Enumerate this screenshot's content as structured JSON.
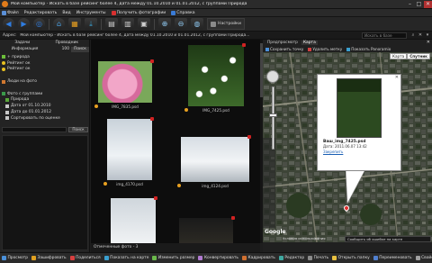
{
  "window": {
    "title": "Мой компьютер - Искать в базе рейсинг более 4, дата между 01.10.2010 и 01.01.2012, с группами Природа",
    "controls": [
      "–",
      "□",
      "✕"
    ]
  },
  "menu": [
    {
      "label": "Файл",
      "color": "#5a8fd6"
    },
    {
      "label": "Редактировать",
      "color": ""
    },
    {
      "label": "Вид",
      "color": ""
    },
    {
      "label": "Инструменты",
      "color": ""
    },
    {
      "label": "Получить фотографии",
      "color": "#d83030"
    },
    {
      "label": "Справка",
      "color": "#3a7bd5"
    }
  ],
  "toolbar": {
    "buttons": [
      {
        "icon": "back-icon",
        "glyph": "◀"
      },
      {
        "icon": "forward-icon",
        "glyph": "▶"
      },
      {
        "icon": "globe-icon",
        "glyph": "◎"
      },
      {
        "icon": "home-icon",
        "glyph": "⌂"
      },
      {
        "icon": "folder-icon",
        "glyph": "▦"
      },
      {
        "icon": "import-icon",
        "glyph": "⤓"
      },
      {
        "icon": "view-icon",
        "glyph": "▤"
      },
      {
        "icon": "grid-icon",
        "glyph": "▥"
      },
      {
        "icon": "slideshow-icon",
        "glyph": "▣"
      },
      {
        "icon": "zoom-in-icon",
        "glyph": "⊕"
      },
      {
        "icon": "zoom-out-icon",
        "glyph": "⊖"
      },
      {
        "icon": "map-icon",
        "glyph": "◍"
      }
    ],
    "settings_label": "Настройки"
  },
  "address": {
    "label": "Адрес:",
    "value": "Мой компьютер - Искать в базе рейсинг более 4, дата между 01.10.2010 и 01.01.2012, с группами Природа...",
    "search_placeholder": "Искать в базе"
  },
  "left": {
    "tab_tasks": "Задачи",
    "tab_explorer": "Проводник",
    "info_label": "Информация",
    "info_value": "100",
    "search_btn": "Поиск",
    "tree": [
      {
        "label": "+ природа",
        "kind": "sq",
        "color": "#6cbf3a"
      },
      {
        "label": "Рейтинг ок",
        "kind": "dot",
        "color": "#e8c020"
      },
      {
        "label": "Рейтинг ок",
        "kind": "dot",
        "color": "#e8c020"
      },
      {
        "label": "",
        "kind": "none",
        "color": ""
      },
      {
        "label": "Люди на фото",
        "kind": "sq",
        "color": "#d07830"
      },
      {
        "label": "",
        "kind": "none",
        "color": ""
      },
      {
        "label": "Фото с группами",
        "kind": "sq",
        "color": "#3a9a4a"
      },
      {
        "label": "Природа",
        "kind": "sq",
        "color": "#5aa83a"
      },
      {
        "label": "Дата от 01.10.2010",
        "kind": "sq",
        "color": "#c8c8c8"
      },
      {
        "label": "Дата до 01.01.2012",
        "kind": "sq",
        "color": "#c8c8c8"
      },
      {
        "label": "Сортировать по оценке",
        "kind": "sq",
        "color": "#c8c8c8"
      }
    ],
    "filter_btn": "Поиск"
  },
  "photos": [
    {
      "caption": "IMG_7835.psd",
      "type": "rose"
    },
    {
      "caption": "IMG_7425.psd",
      "type": "daisy"
    },
    {
      "caption": "img_4170.psd",
      "type": "snow"
    },
    {
      "caption": "img_4124.psd",
      "type": "snow2"
    },
    {
      "caption": "",
      "type": "snow3"
    },
    {
      "caption": "",
      "type": "dark"
    }
  ],
  "status": {
    "selected": "Отмеченные фото - 3"
  },
  "right": {
    "tab1": "Предпросмотр",
    "tab2": "Карта",
    "action1": "Сохранить точку",
    "action2": "Удалить метку",
    "action3": "Показать Panoramio",
    "map_types": [
      "Карта",
      "Спутник"
    ],
    "popup": {
      "title": "Ваш_img_7425.psd",
      "date": "Дата: 2011.06.07 13:42",
      "link": "Закрепить"
    },
    "report": "Сообщить об ошибке на карте",
    "terms": "Условия использования",
    "logo": "Google"
  },
  "bottom": [
    {
      "label": "Просмотр",
      "color": "#4a90d9"
    },
    {
      "label": "Зашифровать",
      "color": "#e0a020"
    },
    {
      "label": "Поделиться",
      "color": "#d84040"
    },
    {
      "label": "Показать на карте",
      "color": "#3aa0d0"
    },
    {
      "label": "Изменить размер",
      "color": "#6ab84a"
    },
    {
      "label": "Конвертировать",
      "color": "#b07ad0"
    },
    {
      "label": "Кадрировать",
      "color": "#d07030"
    },
    {
      "label": "Редактор",
      "color": "#40a8a0"
    },
    {
      "label": "Печать",
      "color": "#8a8a8a"
    },
    {
      "label": "Открыть папку",
      "color": "#e8c040"
    },
    {
      "label": "Переименовать",
      "color": "#5080d0"
    },
    {
      "label": "Свойства",
      "color": "#a0a0a0"
    }
  ]
}
